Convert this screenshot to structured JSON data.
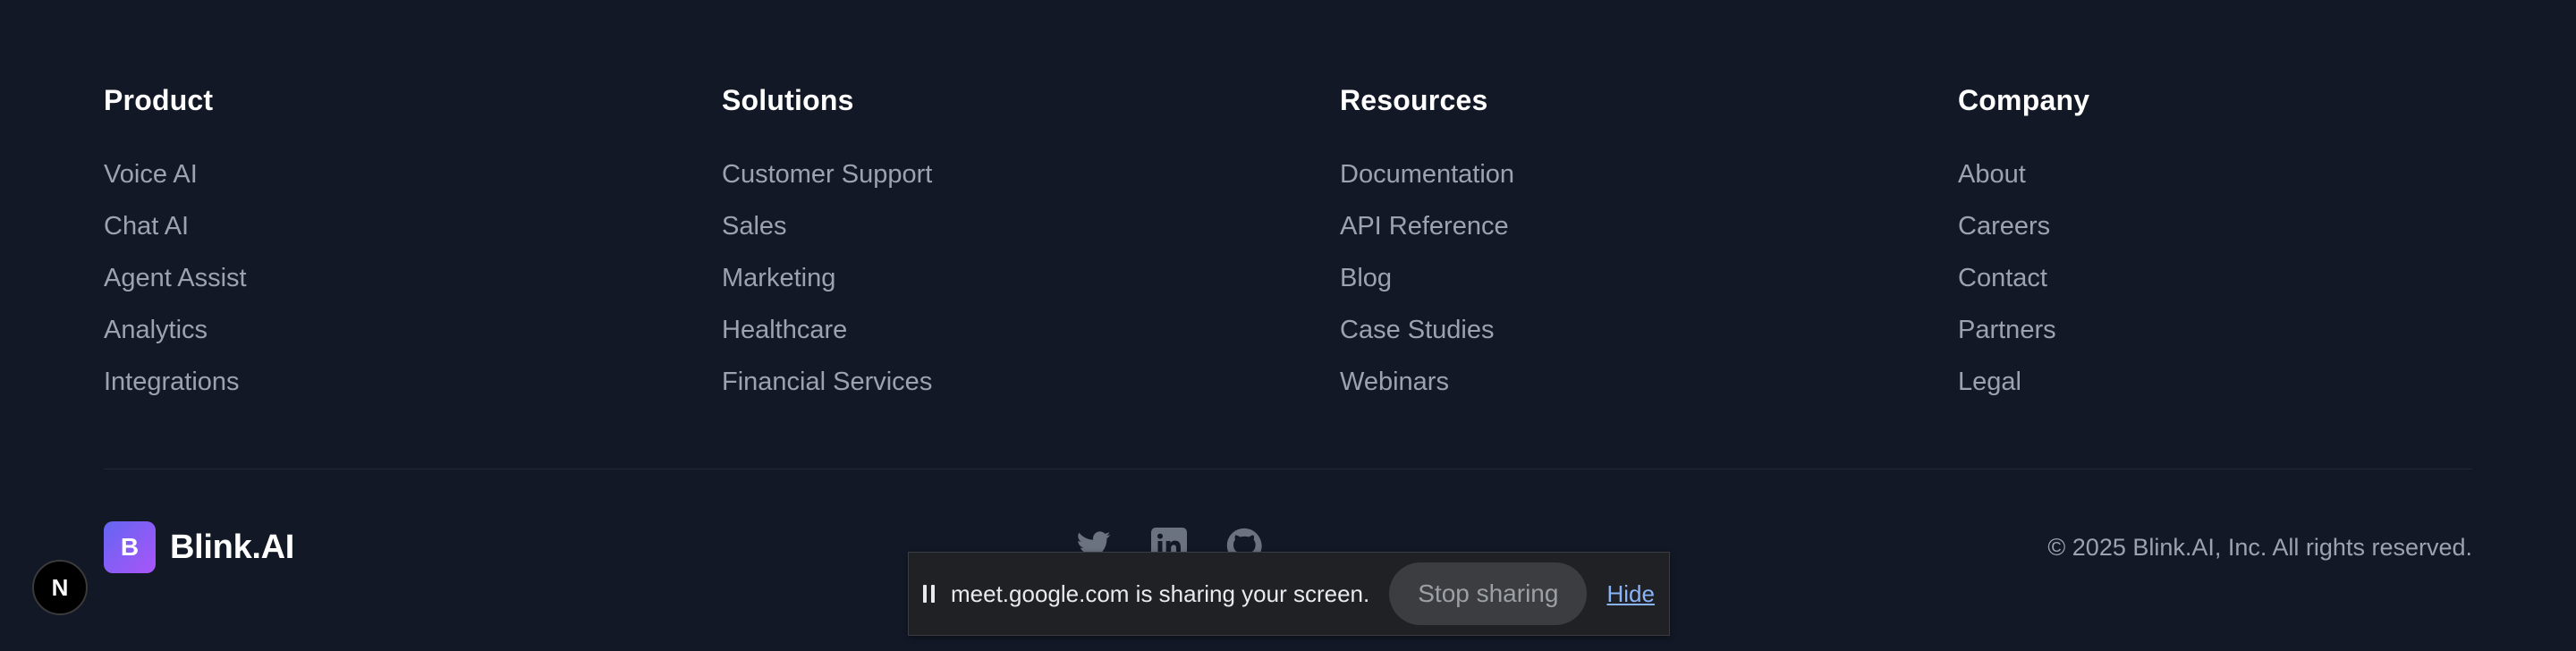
{
  "footer": {
    "columns": [
      {
        "heading": "Product",
        "links": [
          "Voice AI",
          "Chat AI",
          "Agent Assist",
          "Analytics",
          "Integrations"
        ]
      },
      {
        "heading": "Solutions",
        "links": [
          "Customer Support",
          "Sales",
          "Marketing",
          "Healthcare",
          "Financial Services"
        ]
      },
      {
        "heading": "Resources",
        "links": [
          "Documentation",
          "API Reference",
          "Blog",
          "Case Studies",
          "Webinars"
        ]
      },
      {
        "heading": "Company",
        "links": [
          "About",
          "Careers",
          "Contact",
          "Partners",
          "Legal"
        ]
      }
    ],
    "brand": {
      "badge_letter": "B",
      "name": "Blink.AI"
    },
    "socials": [
      "twitter-icon",
      "linkedin-icon",
      "github-icon"
    ],
    "copyright": "© 2025 Blink.AI, Inc. All rights reserved."
  },
  "nextjs_badge": {
    "letter": "N"
  },
  "screen_share_bar": {
    "message": "meet.google.com is sharing your screen.",
    "stop_label": "Stop sharing",
    "hide_label": "Hide"
  },
  "colors": {
    "background": "#121826",
    "heading": "#ffffff",
    "link": "#9ca3af",
    "brand_gradient_start": "#6366f1",
    "brand_gradient_end": "#a855f7",
    "share_bar_bg": "#202124",
    "hide_link": "#8ab4f8"
  }
}
